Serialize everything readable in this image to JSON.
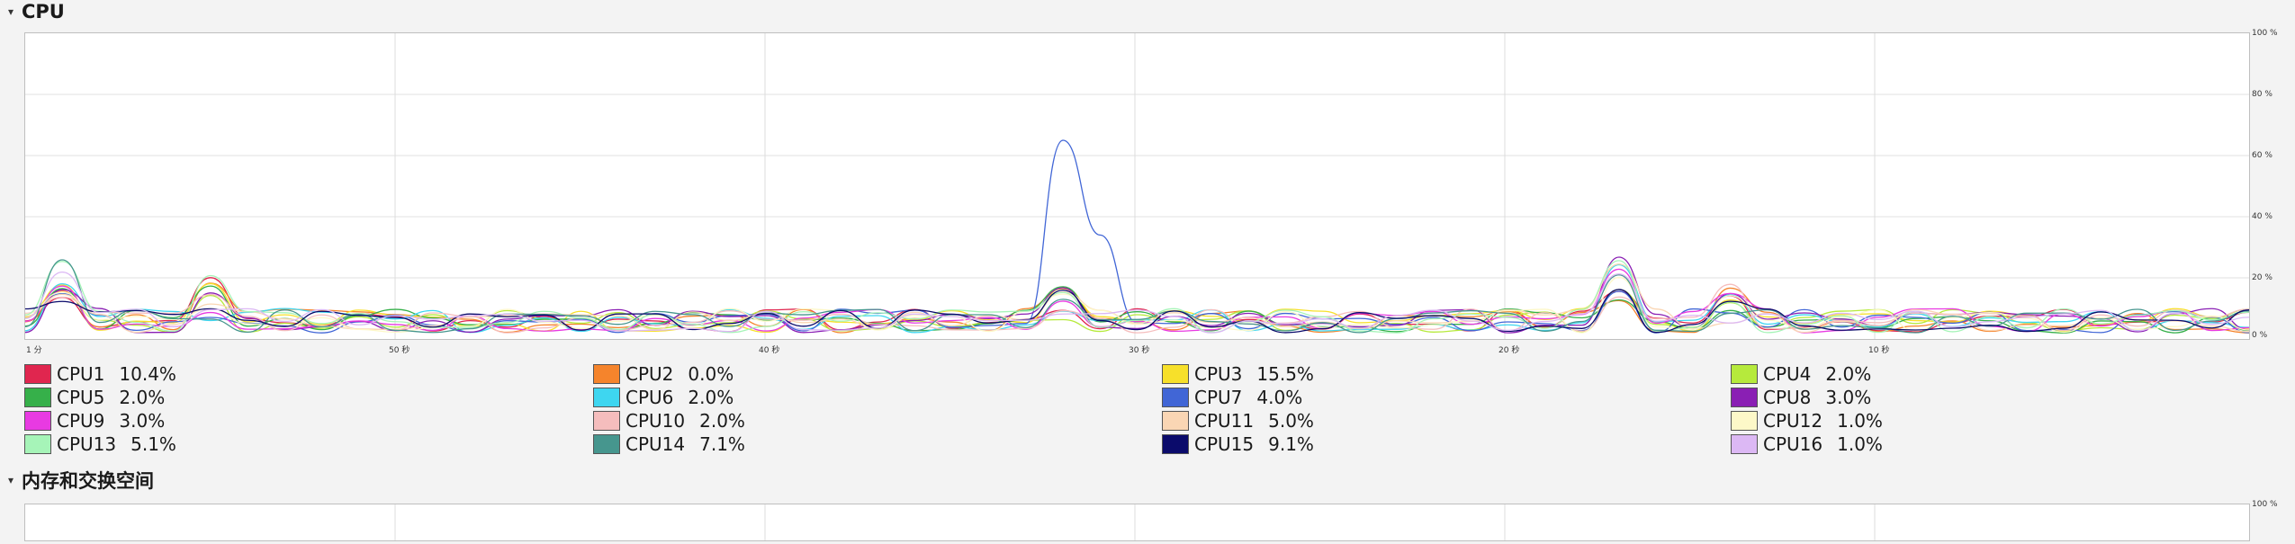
{
  "cpu_section": {
    "title": "CPU",
    "arrow": "▾"
  },
  "memory_section": {
    "title": "内存和交换空间",
    "arrow": "▾"
  },
  "cpu_graph": {
    "y_ticks": [
      "100 %",
      "80 %",
      "60 %",
      "40 %",
      "20 %",
      "0 %"
    ],
    "x_ticks": [
      "1 分",
      "50 秒",
      "40 秒",
      "30 秒",
      "20 秒",
      "10 秒"
    ]
  },
  "memory_graph": {
    "y_ticks": [
      "100 %"
    ]
  },
  "legend": [
    {
      "label": "CPU1",
      "value": "10.4%",
      "color": "#e0264f"
    },
    {
      "label": "CPU2",
      "value": "0.0%",
      "color": "#f5842c"
    },
    {
      "label": "CPU3",
      "value": "15.5%",
      "color": "#f7e02a"
    },
    {
      "label": "CPU4",
      "value": "2.0%",
      "color": "#b6ea3c"
    },
    {
      "label": "CPU5",
      "value": "2.0%",
      "color": "#36b04a"
    },
    {
      "label": "CPU6",
      "value": "2.0%",
      "color": "#3ed6f0"
    },
    {
      "label": "CPU7",
      "value": "4.0%",
      "color": "#4166d6"
    },
    {
      "label": "CPU8",
      "value": "3.0%",
      "color": "#8a1fb4"
    },
    {
      "label": "CPU9",
      "value": "3.0%",
      "color": "#e83ae2"
    },
    {
      "label": "CPU10",
      "value": "2.0%",
      "color": "#f5bdbd"
    },
    {
      "label": "CPU11",
      "value": "5.0%",
      "color": "#fad6b4"
    },
    {
      "label": "CPU12",
      "value": "1.0%",
      "color": "#fdf8c8"
    },
    {
      "label": "CPU13",
      "value": "5.1%",
      "color": "#a6f4b8"
    },
    {
      "label": "CPU14",
      "value": "7.1%",
      "color": "#46968e"
    },
    {
      "label": "CPU15",
      "value": "9.1%",
      "color": "#0b0b6b"
    },
    {
      "label": "CPU16",
      "value": "1.0%",
      "color": "#dcb8f4"
    }
  ]
}
